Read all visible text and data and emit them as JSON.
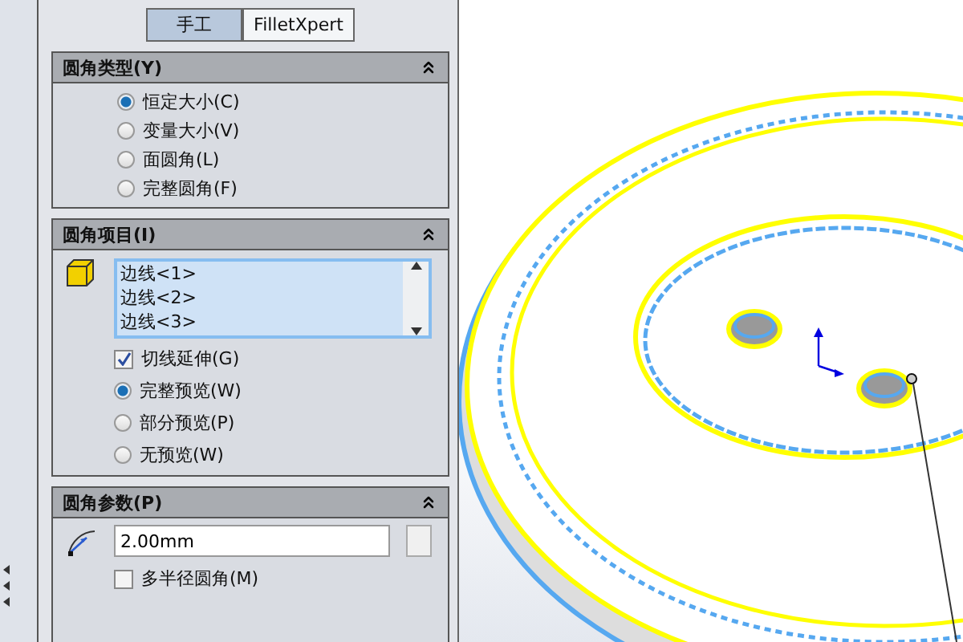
{
  "mode_tabs": [
    {
      "label": "手工",
      "selected": true
    },
    {
      "label": "FilletXpert",
      "selected": false
    }
  ],
  "fillet_type": {
    "title": "圆角类型(Y)",
    "expanded": true,
    "options": [
      {
        "label": "恒定大小(C)",
        "selected": true
      },
      {
        "label": "变量大小(V)",
        "selected": false
      },
      {
        "label": "面圆角(L)",
        "selected": false
      },
      {
        "label": "完整圆角(F)",
        "selected": false
      }
    ]
  },
  "fillet_items": {
    "title": "圆角项目(I)",
    "expanded": true,
    "edges": [
      "边线<1>",
      "边线<2>",
      "边线<3>"
    ],
    "tangent_propagation": {
      "label": "切线延伸(G)",
      "checked": true
    },
    "preview_options": [
      {
        "label": "完整预览(W)",
        "selected": true
      },
      {
        "label": "部分预览(P)",
        "selected": false
      },
      {
        "label": "无预览(W)",
        "selected": false
      }
    ]
  },
  "fillet_parameters": {
    "title": "圆角参数(P)",
    "expanded": true,
    "radius": "2.00mm",
    "multi_radius": {
      "label": "多半径圆角(M)",
      "checked": false
    }
  }
}
